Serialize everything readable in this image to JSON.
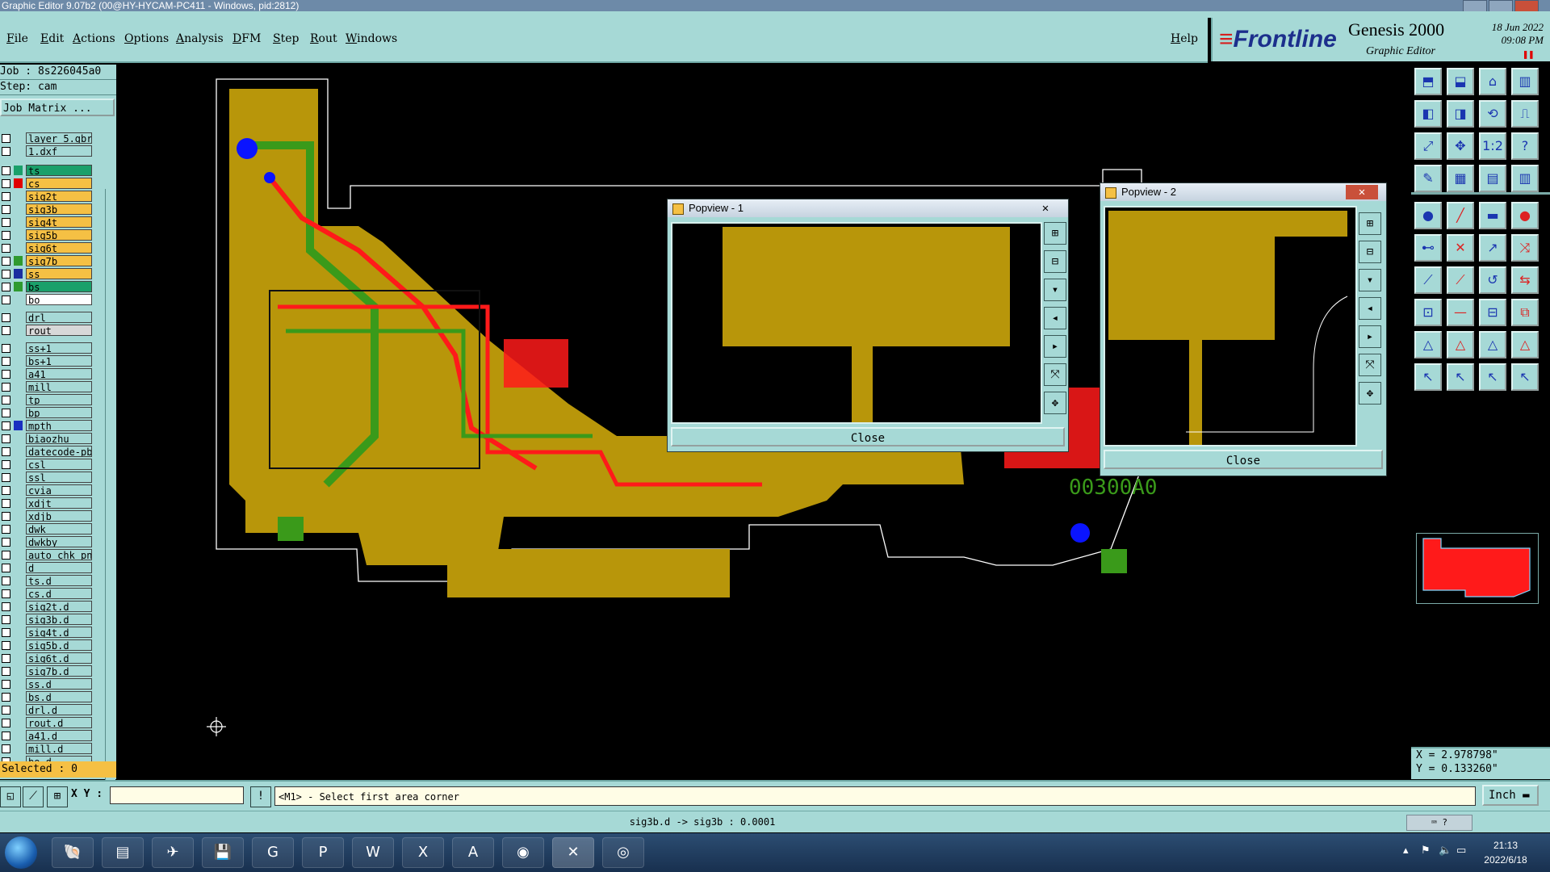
{
  "window": {
    "title": "Graphic Editor 9.07b2 (00@HY-HYCAM-PC411 - Windows, pid:2812)"
  },
  "menu": [
    "File",
    "Edit",
    "Actions",
    "Options",
    "Analysis",
    "DFM",
    "Step",
    "Rout",
    "Windows"
  ],
  "help_label": "Help",
  "brand": {
    "logo": "Frontline",
    "product": "Genesis 2000",
    "subtitle": "Graphic Editor",
    "date": "18 Jun 2022",
    "time": "09:08 PM",
    "pause_icon": "pause-icon"
  },
  "job": {
    "job_line": "Job : 8s226045a0",
    "step_line": "Step: cam",
    "job_matrix_label": "Job Matrix ..."
  },
  "layers": [
    {
      "name": "layer_5.gbr",
      "color": "#a6d9d6"
    },
    {
      "name": "1.dxf",
      "color": "#a6d9d6"
    },
    {
      "name": "ts",
      "color": "#1aa06a",
      "aff": "#1aa06a"
    },
    {
      "name": "cs",
      "color": "#f5c044",
      "aff": "#e00000"
    },
    {
      "name": "sig2t",
      "color": "#f5c044"
    },
    {
      "name": "sig3b",
      "color": "#f5c044"
    },
    {
      "name": "sig4t",
      "color": "#f5c044"
    },
    {
      "name": "sig5b",
      "color": "#f5c044"
    },
    {
      "name": "sig6t",
      "color": "#f5c044"
    },
    {
      "name": "sig7b",
      "color": "#f5c044",
      "aff": "#2f9a2f"
    },
    {
      "name": "ss",
      "color": "#f5c044",
      "aff": "#1a2fa0"
    },
    {
      "name": "bs",
      "color": "#1aa06a",
      "aff": "#2f9a2f"
    },
    {
      "name": "bo",
      "color": "#ffffff"
    },
    {
      "name": "drl",
      "color": "#a6d9d6"
    },
    {
      "name": "rout",
      "color": "#d8d8d8"
    },
    {
      "name": "ss+1",
      "color": "#a6d9d6"
    },
    {
      "name": "bs+1",
      "color": "#a6d9d6"
    },
    {
      "name": "a41",
      "color": "#a6d9d6"
    },
    {
      "name": "mill",
      "color": "#a6d9d6"
    },
    {
      "name": "tp",
      "color": "#a6d9d6"
    },
    {
      "name": "bp",
      "color": "#a6d9d6"
    },
    {
      "name": "mpth",
      "color": "#a6d9d6",
      "aff": "#1a2fc0"
    },
    {
      "name": "biaozhu",
      "color": "#a6d9d6"
    },
    {
      "name": "datecode-pb",
      "color": "#a6d9d6"
    },
    {
      "name": "csl",
      "color": "#a6d9d6"
    },
    {
      "name": "ssl",
      "color": "#a6d9d6"
    },
    {
      "name": "cvia",
      "color": "#a6d9d6"
    },
    {
      "name": "xdjt",
      "color": "#a6d9d6"
    },
    {
      "name": "xdjb",
      "color": "#a6d9d6"
    },
    {
      "name": "dwk",
      "color": "#a6d9d6"
    },
    {
      "name": "dwkby",
      "color": "#a6d9d6"
    },
    {
      "name": "auto_chk_pn",
      "color": "#a6d9d6"
    },
    {
      "name": "d",
      "color": "#a6d9d6"
    },
    {
      "name": "ts.d",
      "color": "#a6d9d6"
    },
    {
      "name": "cs.d",
      "color": "#a6d9d6"
    },
    {
      "name": "sig2t.d",
      "color": "#a6d9d6"
    },
    {
      "name": "sig3b.d",
      "color": "#a6d9d6"
    },
    {
      "name": "sig4t.d",
      "color": "#a6d9d6"
    },
    {
      "name": "sig5b.d",
      "color": "#a6d9d6"
    },
    {
      "name": "sig6t.d",
      "color": "#a6d9d6"
    },
    {
      "name": "sig7b.d",
      "color": "#a6d9d6"
    },
    {
      "name": "ss.d",
      "color": "#a6d9d6"
    },
    {
      "name": "bs.d",
      "color": "#a6d9d6"
    },
    {
      "name": "drl.d",
      "color": "#a6d9d6"
    },
    {
      "name": "rout.d",
      "color": "#a6d9d6"
    },
    {
      "name": "a41.d",
      "color": "#a6d9d6"
    },
    {
      "name": "mill.d",
      "color": "#a6d9d6"
    },
    {
      "name": "bo.d",
      "color": "#a6d9d6"
    }
  ],
  "selected_text": "Selected : 0",
  "canvas": {
    "pcb_text": "00300A0",
    "colors": {
      "copper": "#b8960a",
      "red": "#ff1a1a",
      "green": "#3a9a1a",
      "outline": "#ffffff",
      "via": "#0a14ff"
    }
  },
  "popup1": {
    "title": "Popview - 1",
    "close_label": "Close"
  },
  "popup2": {
    "title": "Popview - 2",
    "close_label": "Close"
  },
  "tools": [
    "zoom-home-icon",
    "zoom-out-icon",
    "home-icon",
    "grid-icon",
    "pan-left-icon",
    "pan-right-icon",
    "redraw-icon",
    "snap-icon",
    "fit-icon",
    "zoom-fit-icon",
    "scale-1-2-icon",
    "query-icon",
    "measure-icon",
    "grid-display-icon",
    "layer-display-icon",
    "layer-compare-icon",
    "pad-icon",
    "line-icon",
    "text-icon",
    "circle-icon",
    "connect-icon",
    "cut-icon",
    "move-icon",
    "copy-icon",
    "slope-icon",
    "draw-icon",
    "arc-icon",
    "flip-icon",
    "place-icon",
    "delete-icon",
    "panel-icon",
    "group-icon",
    "outline-icon",
    "triangle-icon",
    "polygon-icon",
    "hatch-icon",
    "select-icon",
    "select-area-icon",
    "select-net-icon",
    "select-multi-icon"
  ],
  "coords": {
    "x": "X = 2.978798\"",
    "y": "Y = 0.133260\""
  },
  "command": {
    "xy_label": "X Y :",
    "input_value": "",
    "message": "<M1> - Select first area corner",
    "unit": "Inch"
  },
  "status_text": "sig3b.d -> sig3b : 0.0001",
  "taskbar": {
    "clock_time": "21:13",
    "clock_date": "2022/6/18"
  }
}
